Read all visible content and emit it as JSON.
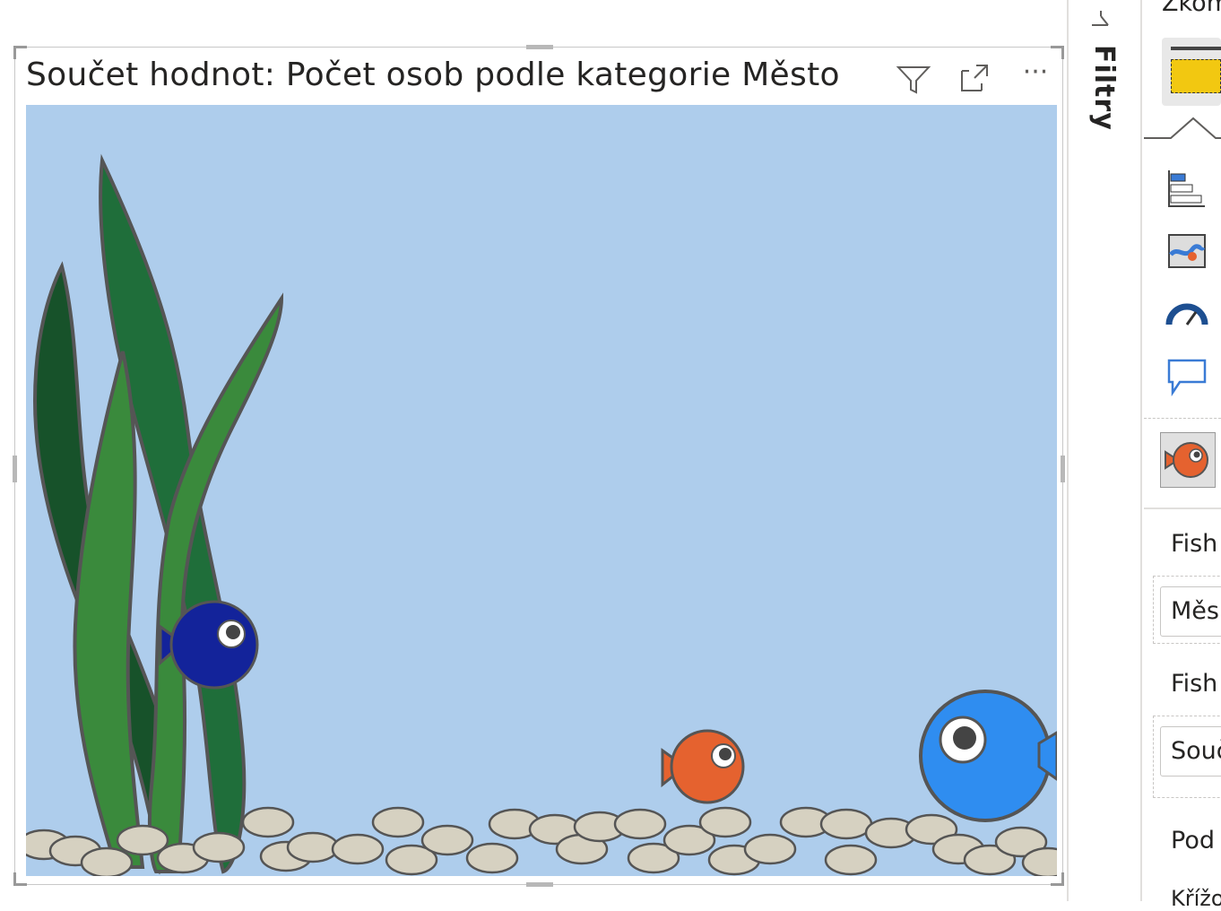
{
  "visual": {
    "title": "Součet hodnot: Počet osob podle kategorie Město",
    "header_icons": [
      "filter-icon",
      "focus-mode-icon",
      "more-options-icon"
    ],
    "more_options_glyph": "···",
    "background_color": "#aecdec"
  },
  "filters_pane": {
    "label": "Filtry"
  },
  "visualizations_pane": {
    "top_label": "Zkom",
    "icons": [
      "table-icon",
      "stacked-bar-icon",
      "map-icon",
      "gauge-icon",
      "speech-bubble-icon",
      "fish-visual-icon"
    ],
    "section_1_label": "Fish",
    "section_1_field": "Měs",
    "section_2_label": "Fish",
    "section_2_field": "Souč",
    "section_3_label": "Pod",
    "section_4_label": "Křížo"
  },
  "fish": [
    {
      "name": "blue-dark-fish",
      "color": "#13239a"
    },
    {
      "name": "orange-fish",
      "color": "#e5622f"
    },
    {
      "name": "blue-large-fish",
      "color": "#2f8df0"
    }
  ],
  "colors": {
    "water": "#aecdec",
    "plant_light": "#3a8a3c",
    "plant_dark": "#17522a",
    "pebble": "#d6d1c1",
    "outline": "#555555"
  }
}
